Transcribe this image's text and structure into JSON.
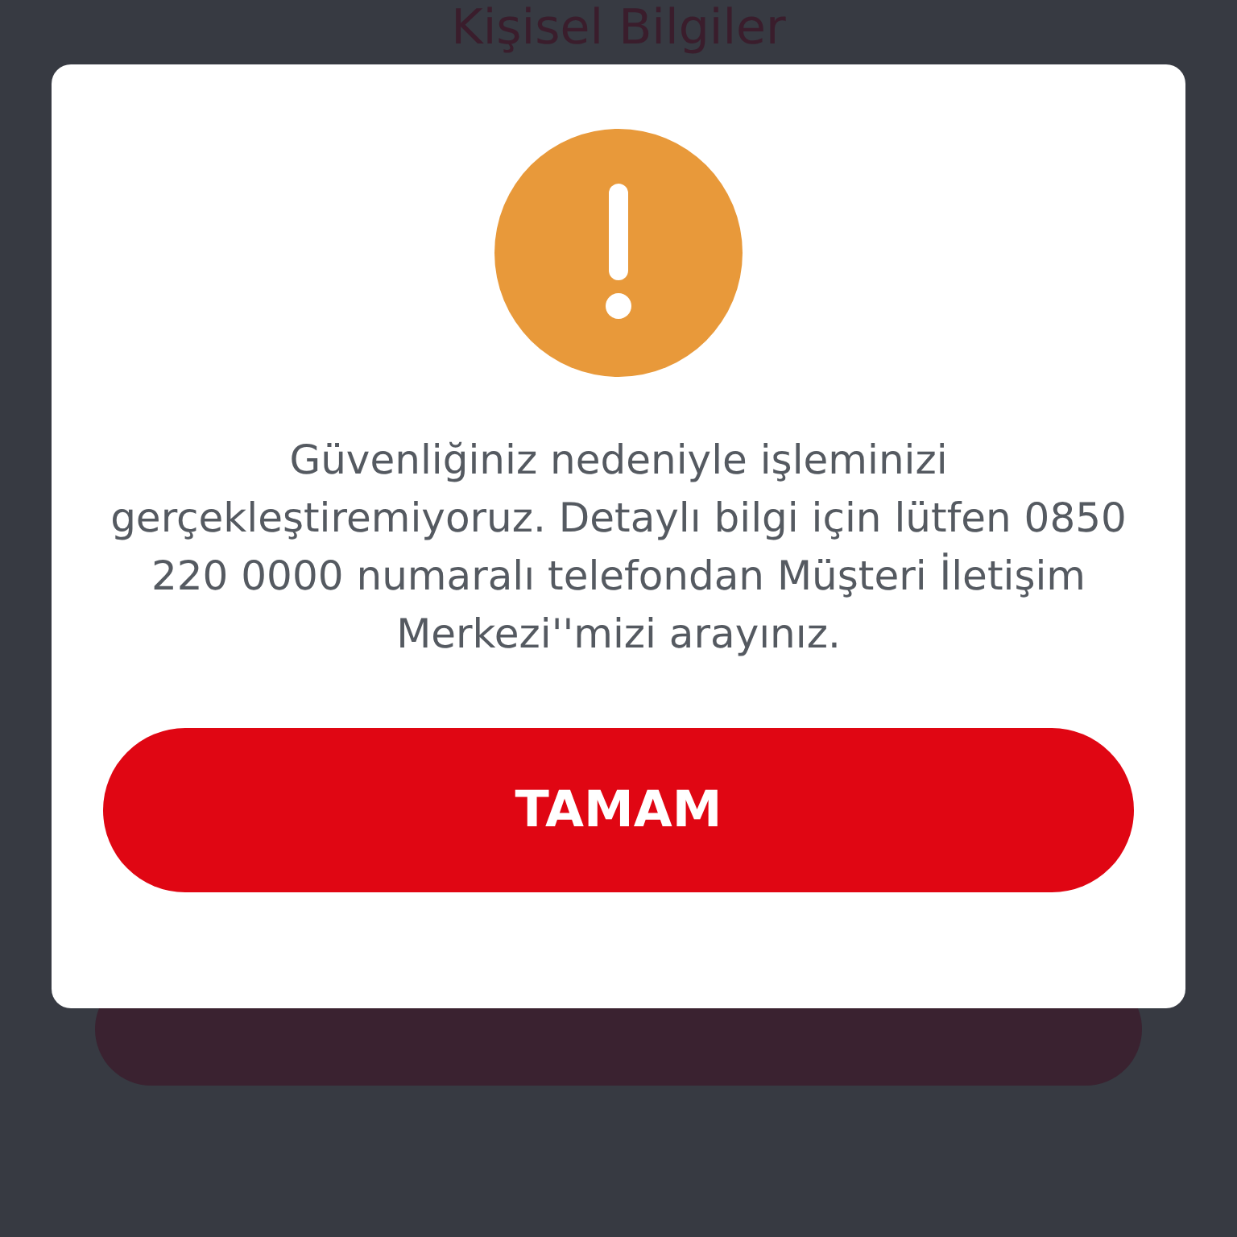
{
  "page": {
    "title": "Kişisel Bilgiler"
  },
  "dialog": {
    "kind": "warning",
    "message": "Güvenliğiniz nedeniyle işleminizi gerçekleştiremiyoruz. Detaylı bilgi için lütfen 0850 220 0000 numaralı telefondan Müşteri İletişim Merkezi''mizi arayınız.",
    "button": "TAMAM"
  }
}
